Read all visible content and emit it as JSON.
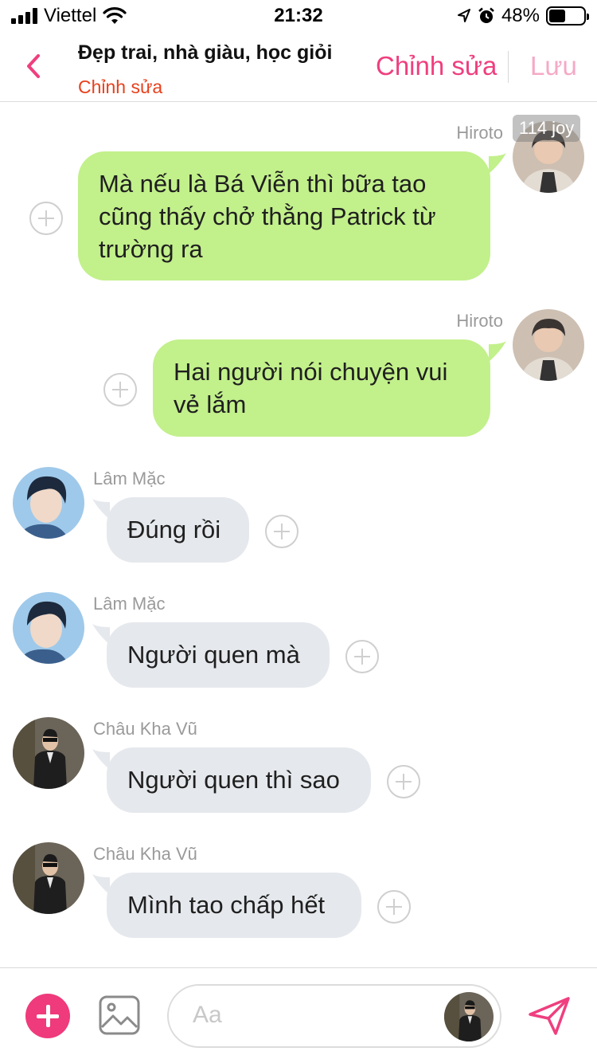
{
  "status_bar": {
    "carrier": "Viettel",
    "time": "21:32",
    "battery": "48%",
    "battery_level": 0.48
  },
  "header": {
    "title": "Đẹp trai, nhà giàu, học giỏi",
    "subtitle": "Chỉnh sửa",
    "edit_label": "Chỉnh sửa",
    "save_label": "Lưu"
  },
  "overlay_badge": "114 joy",
  "messages": [
    {
      "sender": "Hiroto",
      "text": "Mà nếu là Bá Viễn thì bữa tao cũng thấy chở thằng Patrick từ trường ra",
      "direction": "outgoing"
    },
    {
      "sender": "Hiroto",
      "text": "Hai người nói chuyện vui vẻ lắm",
      "direction": "outgoing"
    },
    {
      "sender": "Lâm Mặc",
      "text": "Đúng rồi",
      "direction": "incoming"
    },
    {
      "sender": "Lâm Mặc",
      "text": "Người quen mà",
      "direction": "incoming"
    },
    {
      "sender": "Châu Kha Vũ",
      "text": "Người quen thì sao",
      "direction": "incoming"
    },
    {
      "sender": "Châu Kha Vũ",
      "text": "Mình tao chấp hết",
      "direction": "incoming"
    }
  ],
  "composer": {
    "placeholder": "Aa"
  },
  "colors": {
    "accent": "#ef3f7f",
    "subtitle": "#e8401c",
    "outgoing_bubble": "#c2f08b",
    "incoming_bubble": "#e5e8ec"
  },
  "icons": [
    "back-chevron-icon",
    "plus-circle-icon",
    "image-icon",
    "send-icon",
    "wifi-icon",
    "location-icon",
    "alarm-icon"
  ]
}
